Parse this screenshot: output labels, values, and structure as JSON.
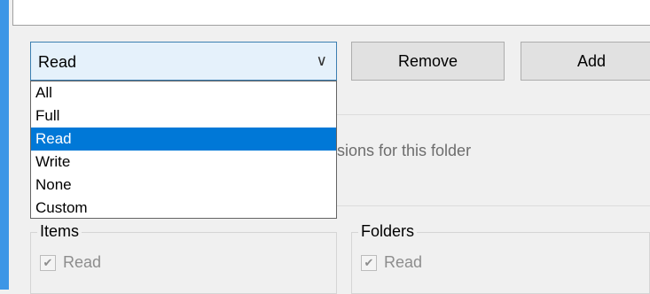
{
  "permission_combo": {
    "selected": "Read",
    "options": [
      "All",
      "Full",
      "Read",
      "Write",
      "None",
      "Custom"
    ],
    "selected_index": 2
  },
  "buttons": {
    "remove_label": "Remove",
    "add_label": "Add"
  },
  "description_fragment": "sions for this folder",
  "groups": {
    "items": {
      "legend": "Items",
      "read_label": "Read",
      "read_checked": true
    },
    "folders": {
      "legend": "Folders",
      "read_label": "Read",
      "read_checked": true
    }
  },
  "colors": {
    "accent_strip": "#3c96e6",
    "selection": "#0078d7",
    "combo_focus_bg": "#e5f1fb"
  }
}
